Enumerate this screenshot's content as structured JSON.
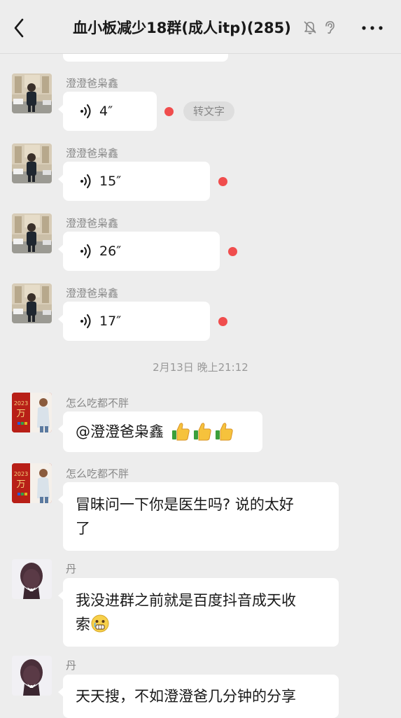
{
  "header": {
    "title": "血小板减少18群(成人itp)(285)",
    "back_icon": "chevron-left-icon",
    "mute_icon": "bell-off-icon",
    "ear_icon": "ear-icon",
    "more_icon": "more-icon"
  },
  "voice_messages": [
    {
      "sender": "澄澄爸枭鑫",
      "duration": "4″",
      "unread": true,
      "convert_label": "转文字"
    },
    {
      "sender": "澄澄爸枭鑫",
      "duration": "15″",
      "unread": true
    },
    {
      "sender": "澄澄爸枭鑫",
      "duration": "26″",
      "unread": true
    },
    {
      "sender": "澄澄爸枭鑫",
      "duration": "17″",
      "unread": true
    }
  ],
  "timestamp": "2月13日 晚上21:12",
  "text_messages": [
    {
      "sender": "怎么吃都不胖",
      "text": "@澄澄爸枭鑫 ",
      "emoji": [
        "thumbs-up",
        "thumbs-up",
        "thumbs-up"
      ]
    },
    {
      "sender": "怎么吃都不胖",
      "line1": "冒昧问一下你是医生吗? 说的太好",
      "line2": "了"
    },
    {
      "sender": "丹",
      "line1": "我没进群之前就是百度抖音成天收",
      "line2": "索",
      "emoji": "grimacing-tear-face"
    },
    {
      "sender": "丹",
      "text": "天天搜，不如澄澄爸几分钟的分享"
    }
  ],
  "avatar_text": {
    "year": "2023",
    "char": "万"
  },
  "colors": {
    "background": "#ededed",
    "bubble": "#ffffff",
    "unread_dot": "#f04d4d",
    "meta_text": "#888888"
  }
}
